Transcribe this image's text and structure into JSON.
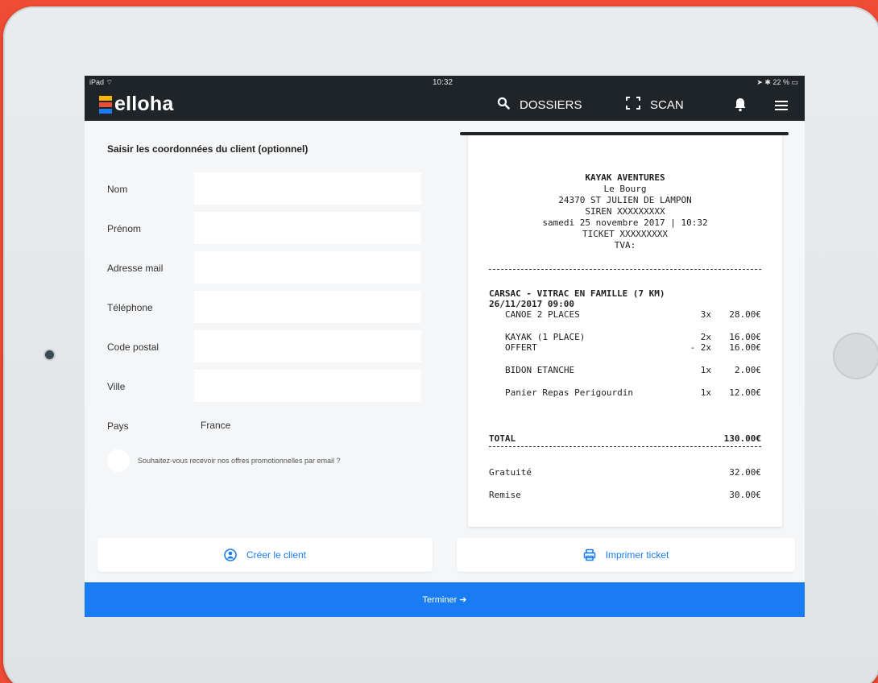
{
  "status_bar": {
    "device": "iPad",
    "time": "10:32",
    "battery": "22 %"
  },
  "header": {
    "brand": "elloha",
    "nav": {
      "dossiers_label": "DOSSIERS",
      "scan_label": "SCAN"
    }
  },
  "form": {
    "title": "Saisir les coordonnées du client (optionnel)",
    "fields": [
      {
        "label": "Nom",
        "value": ""
      },
      {
        "label": "Prénom",
        "value": ""
      },
      {
        "label": "Adresse mail",
        "value": ""
      },
      {
        "label": "Téléphone",
        "value": ""
      },
      {
        "label": "Code postal",
        "value": ""
      },
      {
        "label": "Ville",
        "value": ""
      },
      {
        "label": "Pays",
        "value": "France"
      }
    ],
    "promo_label": "Souhaitez-vous recevoir nos offres promotionnelles par email ?"
  },
  "receipt": {
    "company": "KAYAK AVENTURES",
    "address1": "Le Bourg",
    "address2": "24370 ST JULIEN DE LAMPON",
    "siren": "SIREN XXXXXXXXX",
    "date": "samedi 25 novembre 2017 | 10:32",
    "ticket": "TICKET XXXXXXXXX",
    "tva": "TVA:",
    "activity": "CARSAC - VITRAC EN FAMILLE (7 KM)",
    "activity_date": "26/11/2017 09:00",
    "items": [
      {
        "label": "CANOE 2 PLACES",
        "qty": "3x",
        "price": "28.00€"
      },
      {
        "label": "KAYAK (1 PLACE)",
        "qty": "2x",
        "price": "16.00€"
      },
      {
        "label": "OFFERT",
        "qty": "- 2x",
        "price": "16.00€"
      },
      {
        "label": "BIDON ETANCHE",
        "qty": "1x",
        "price": "2.00€"
      },
      {
        "label": "Panier Repas Perigourdin",
        "qty": "1x",
        "price": "12.00€"
      }
    ],
    "total_label": "TOTAL",
    "total_value": "130.00€",
    "gratuite_label": "Gratuité",
    "gratuite_value": "32.00€",
    "remise_label": "Remise",
    "remise_value": "30.00€"
  },
  "actions": {
    "create_client": "Créer le client",
    "print_ticket": "Imprimer ticket",
    "finish": "Terminer ➜"
  },
  "colors": {
    "accent": "#1a7cf2",
    "header_bg": "#1f2428",
    "frame_bg": "#ee4c35"
  }
}
